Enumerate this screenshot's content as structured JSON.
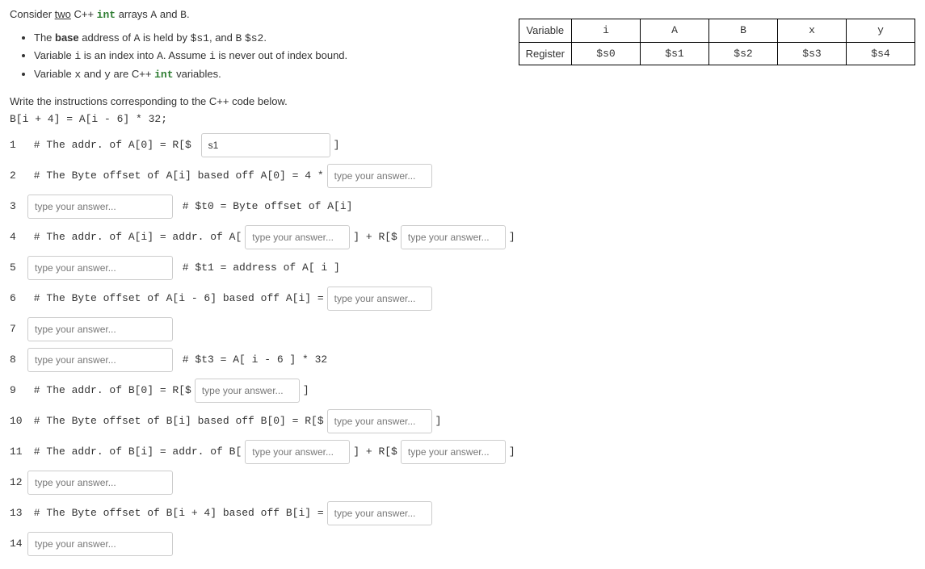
{
  "intro": {
    "l1_a": "Consider ",
    "l1_b": "two",
    "l1_c": " C++ ",
    "l1_d": "int",
    "l1_e": " arrays ",
    "l1_f": "A",
    "l1_g": " and ",
    "l1_h": "B",
    "l1_i": "."
  },
  "bullets": {
    "b1_a": "The ",
    "b1_b": "base",
    "b1_c": " address of ",
    "b1_d": "A",
    "b1_e": " is held by ",
    "b1_f": "$s1",
    "b1_g": ", and ",
    "b1_h": "B",
    "b1_i": " ",
    "b1_j": "$s2",
    "b1_k": ".",
    "b2_a": "Variable ",
    "b2_b": "i",
    "b2_c": " is an index into ",
    "b2_d": "A",
    "b2_e": ". Assume ",
    "b2_f": "i",
    "b2_g": " is never out of index bound.",
    "b3_a": "Variable ",
    "b3_b": "x",
    "b3_c": " and ",
    "b3_d": "y",
    "b3_e": " are C++ ",
    "b3_f": "int",
    "b3_g": " variables."
  },
  "question": "Write the instructions corresponding to the C++ code below.",
  "codeExpr": "B[i + 4] = A[i - 6] * 32;",
  "placeholder": "type your answer...",
  "table": {
    "r1c0": "Variable",
    "r1c1": "i",
    "r1c2": "A",
    "r1c3": "B",
    "r1c4": "x",
    "r1c5": "y",
    "r2c0": "Register",
    "r2c1": "$s0",
    "r2c2": "$s1",
    "r2c3": "$s2",
    "r2c4": "$s3",
    "r2c5": "$s4"
  },
  "lines": {
    "n1": "1",
    "l1a": " # The addr. of A[0] = R[$ ",
    "l1fill": "s1",
    "l1b": "]",
    "n2": "2",
    "l2a": " # The Byte offset of A[i] based off A[0] = 4 *",
    "n3": "3",
    "l3b": " # $t0 = Byte offset of A[i]",
    "n4": "4",
    "l4a": " # The addr. of A[i] = addr. of A[",
    "l4b": "] + R[$",
    "l4c": "]",
    "n5": "5",
    "l5b": " # $t1 = address of A[ i ]",
    "n6": "6",
    "l6a": " # The Byte offset of A[i - 6] based off A[i] =",
    "n7": "7",
    "n8": "8",
    "l8b": " # $t3 = A[ i - 6 ] * 32",
    "n9": "9",
    "l9a": " # The addr. of B[0] = R[$",
    "l9b": "]",
    "n10": "10",
    "l10a": " # The Byte offset of B[i] based off B[0] = R[$",
    "l10b": "]",
    "n11": "11",
    "l11a": " # The addr. of B[i] = addr. of B[",
    "l11b": "] + R[$",
    "l11c": "]",
    "n12": "12",
    "n13": "13",
    "l13a": " # The Byte offset of B[i + 4] based off B[i] =",
    "n14": "14"
  }
}
